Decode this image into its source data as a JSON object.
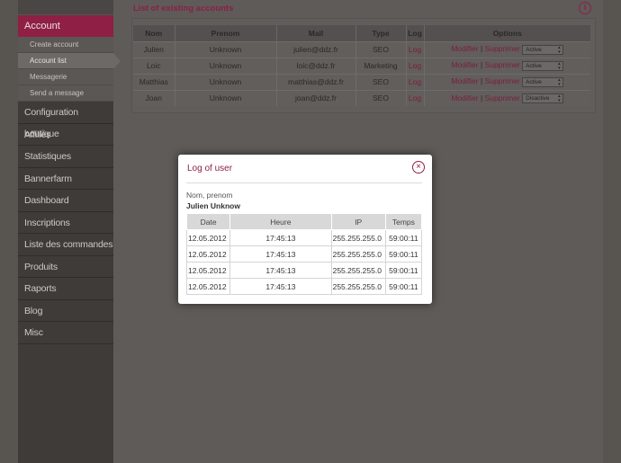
{
  "sidebar": {
    "active_section": "Account",
    "subitems": [
      "Create account",
      "Account list",
      "Messagerie",
      "Send a message"
    ],
    "items": [
      "Configuration boutique",
      "Affiliés",
      "Statistiques",
      "Bannerfarm",
      "Dashboard",
      "Inscriptions",
      "Liste des commandes",
      "Produits",
      "Raports",
      "Blog",
      "Misc"
    ]
  },
  "main": {
    "title": "List of existing accounts",
    "columns": [
      "Nom",
      "Prenom",
      "Mail",
      "Type",
      "Log",
      "Options"
    ],
    "rows": [
      {
        "nom": "Julien",
        "prenom": "Unknown",
        "mail": "julien@ddz.fr",
        "type": "SEO",
        "log": "Log",
        "modify": "Modifier",
        "sep": "|",
        "delete": "Supprimer",
        "status": "Active"
      },
      {
        "nom": "Loic",
        "prenom": "Unknown",
        "mail": "loic@ddz.fr",
        "type": "Marketing",
        "log": "Log",
        "modify": "Modifier",
        "sep": "|",
        "delete": "Supprimer",
        "status": "Active"
      },
      {
        "nom": "Matthias",
        "prenom": "Unknown",
        "mail": "matthias@ddz.fr",
        "type": "SEO",
        "log": "Log",
        "modify": "Modifier",
        "sep": "|",
        "delete": "Supprimer",
        "status": "Active"
      },
      {
        "nom": "Joan",
        "prenom": "Unknown",
        "mail": "joan@ddz.fr",
        "type": "SEO",
        "log": "Log",
        "modify": "Modifier",
        "sep": "|",
        "delete": "Supprimer",
        "status": "Disactive"
      }
    ]
  },
  "modal": {
    "title": "Log of user",
    "user_label": "Nom, prenom",
    "user_name": "Julien Unknow",
    "columns": [
      "Date",
      "Heure",
      "IP",
      "Temps"
    ],
    "rows": [
      [
        "12.05.2012",
        "17:45:13",
        "255.255.255.0",
        "59:00:11"
      ],
      [
        "12.05.2012",
        "17:45:13",
        "255.255.255.0",
        "59:00:11"
      ],
      [
        "12.05.2012",
        "17:45:13",
        "255.255.255.0",
        "59:00:11"
      ],
      [
        "12.05.2012",
        "17:45:13",
        "255.255.255.0",
        "59:00:11"
      ]
    ]
  },
  "colors": {
    "accent": "#8e1f48",
    "overlay_bg": "#5f5b58"
  }
}
